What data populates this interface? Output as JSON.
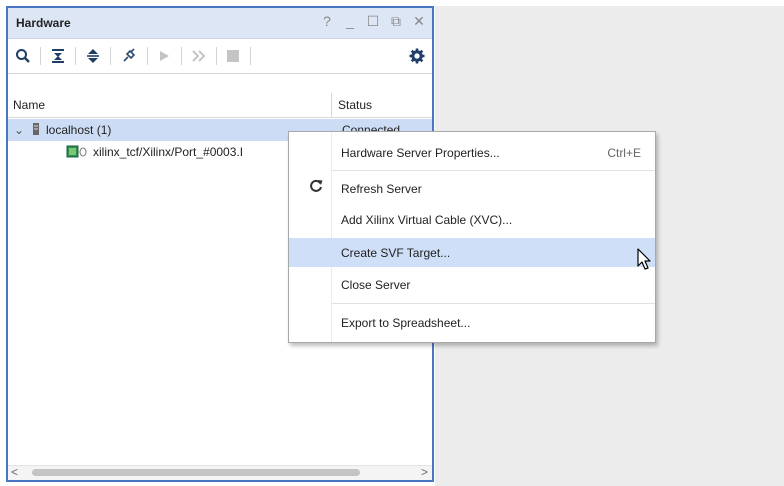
{
  "panel": {
    "title": "Hardware",
    "title_controls": [
      "?",
      "_",
      "☐",
      "⧉",
      "✕"
    ],
    "toolbar_icons": [
      "search-icon",
      "collapse-all-icon",
      "expand-all-icon",
      "auto-connect-icon",
      "run-icon",
      "fast-forward-icon",
      "stop-icon",
      "gear-icon"
    ],
    "columns": {
      "name": "Name",
      "status": "Status"
    },
    "tree": [
      {
        "label": "localhost (1)",
        "status": "Connected",
        "expanded": true,
        "icon": "server-icon"
      },
      {
        "label": "xilinx_tcf/Xilinx/Port_#0003.I",
        "status": "",
        "icon": "jtag-cable-icon"
      }
    ],
    "scroll_left": "<",
    "scroll_right": ">"
  },
  "context_menu": {
    "items": [
      {
        "label": "Hardware Server Properties...",
        "shortcut": "Ctrl+E",
        "icon": ""
      },
      {
        "label": "Refresh Server",
        "shortcut": "",
        "icon": "refresh-icon"
      },
      {
        "label": "Add Xilinx Virtual Cable (XVC)...",
        "shortcut": "",
        "icon": ""
      },
      {
        "label": "Create SVF Target...",
        "shortcut": "",
        "icon": "",
        "hovered": true
      },
      {
        "label": "Close Server",
        "shortcut": "",
        "icon": ""
      },
      {
        "label": "Export to Spreadsheet...",
        "shortcut": "",
        "icon": ""
      }
    ]
  },
  "colors": {
    "panel_border": "#4a77c4",
    "title_bg": "#dde6f5",
    "selection_bg": "#cddcf5",
    "menu_hover": "#cfdff7"
  }
}
